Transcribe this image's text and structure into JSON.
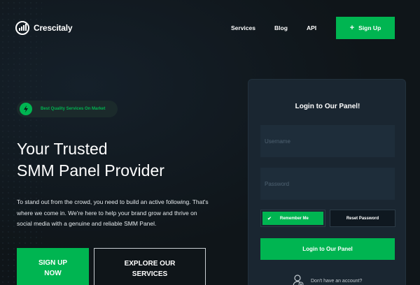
{
  "brand": {
    "name": "Crescitaly"
  },
  "nav": {
    "links": [
      {
        "label": "Services"
      },
      {
        "label": "Blog"
      },
      {
        "label": "API"
      }
    ],
    "signup_label": "Sign Up"
  },
  "hero": {
    "badge": "Best Quality Services On Market",
    "title_line1": "Your Trusted",
    "title_line2": "SMM Panel Provider",
    "description": "To stand out from the crowd, you need to build an active following. That's where we come in. We're here to help your brand grow and thrive on social media with a genuine and reliable SMM Panel.",
    "cta_primary_line1": "SIGN UP",
    "cta_primary_line2": "NOW",
    "cta_secondary_line1": "EXPLORE OUR",
    "cta_secondary_line2": "SERVICES"
  },
  "login": {
    "title": "Login to Our Panel!",
    "username_placeholder": "Username",
    "password_placeholder": "Password",
    "remember_label": "Remember Me",
    "reset_label": "Reset Password",
    "submit_label": "Login to Our Panel",
    "no_account": "Don't have an account?"
  },
  "colors": {
    "accent": "#00b551",
    "background": "#0f1519",
    "panel": "#1a2631"
  },
  "icons": {
    "logo": "bar-chart-logo-icon",
    "signup": "plus-icon",
    "badge": "lightning-icon",
    "remember": "check-icon",
    "account": "user-icon"
  }
}
